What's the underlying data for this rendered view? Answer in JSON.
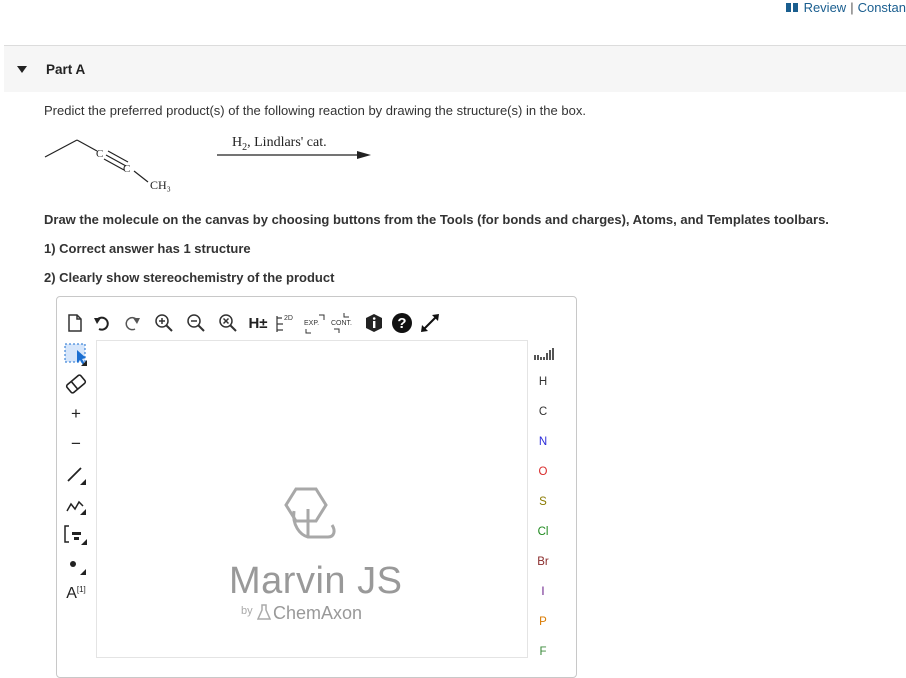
{
  "header": {
    "review_label": "Review",
    "separator": "|",
    "constants_label": "Constan"
  },
  "part": {
    "title": "Part A"
  },
  "question": {
    "prompt": "Predict the preferred product(s) of the following reaction by drawing the structure(s) in the box.",
    "reagent_h": "H",
    "reagent_sub": "2",
    "reagent_rest": ", Lindlars' cat.",
    "ch3_label": "CH₃",
    "alkyne_c1": "C",
    "alkyne_c2": "C"
  },
  "instructions": {
    "main": "Draw the molecule on the canvas by choosing buttons from the Tools (for bonds and charges), Atoms, and Templates toolbars.",
    "step1": "1) Correct answer has 1 structure",
    "step2": "2) Clearly show stereochemistry of the product"
  },
  "editor": {
    "toolbar": {
      "h_label": "H±",
      "twod_label": "2D",
      "exp_label": "EXP.",
      "cont_label": "CONT."
    },
    "left_tools": {
      "bracket_label": "[1]",
      "atom_tool_label": "A"
    },
    "atoms": [
      "H",
      "C",
      "N",
      "O",
      "S",
      "Cl",
      "Br",
      "I",
      "P",
      "F"
    ],
    "atom_colors": {
      "H": "#333333",
      "C": "#333333",
      "N": "#2b2bd9",
      "O": "#d92b2b",
      "S": "#8a7a00",
      "Cl": "#1f8a1f",
      "Br": "#8a2b2b",
      "I": "#6a1f8a",
      "P": "#d97a00",
      "F": "#3a8a3a"
    },
    "logo": {
      "title": "Marvin JS",
      "by": "by",
      "vendor": "ChemAxon"
    }
  },
  "colors": {
    "link": "#1a5e8f",
    "toolbar_icon": "#333333",
    "accent": "#1b6fd1"
  }
}
